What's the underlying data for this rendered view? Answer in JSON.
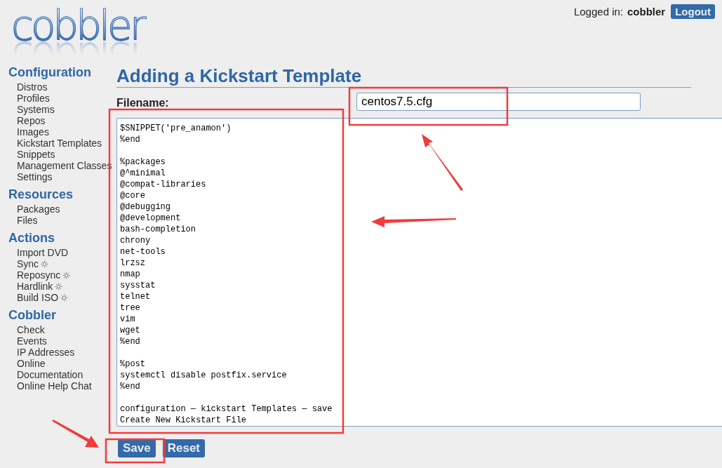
{
  "header": {
    "logo": "cobbler",
    "logged_in_label": "Logged in:",
    "user": "cobbler",
    "logout": "Logout"
  },
  "sidebar": [
    {
      "heading": "Configuration",
      "items": [
        {
          "label": "Distros",
          "kind": "link"
        },
        {
          "label": "Profiles",
          "kind": "link"
        },
        {
          "label": "Systems",
          "kind": "link"
        },
        {
          "label": "Repos",
          "kind": "link"
        },
        {
          "label": "Images",
          "kind": "link"
        },
        {
          "label": "Kickstart Templates",
          "kind": "link"
        },
        {
          "label": "Snippets",
          "kind": "link"
        },
        {
          "label": "Management Classes",
          "kind": "link"
        },
        {
          "label": "Settings",
          "kind": "link"
        }
      ]
    },
    {
      "heading": "Resources",
      "items": [
        {
          "label": "Packages",
          "kind": "link"
        },
        {
          "label": "Files",
          "kind": "link"
        }
      ]
    },
    {
      "heading": "Actions",
      "items": [
        {
          "label": "Import DVD",
          "kind": "link"
        },
        {
          "label": "Sync",
          "kind": "task"
        },
        {
          "label": "Reposync",
          "kind": "task"
        },
        {
          "label": "Hardlink",
          "kind": "task"
        },
        {
          "label": "Build ISO",
          "kind": "task"
        }
      ]
    },
    {
      "heading": "Cobbler",
      "items": [
        {
          "label": "Check",
          "kind": "link"
        },
        {
          "label": "Events",
          "kind": "link"
        },
        {
          "label": "IP Addresses",
          "kind": "link"
        },
        {
          "label": "Online",
          "kind": "link"
        },
        {
          "label": "Documentation",
          "kind": "link"
        },
        {
          "label": "Online Help Chat",
          "kind": "link"
        }
      ]
    }
  ],
  "page": {
    "title": "Adding a Kickstart Template",
    "filename_label": "Filename:",
    "filename": "centos7.5.cfg",
    "editor": {
      "value": "$SNIPPET('pre_anamon')\n%end\n\n%packages\n@^minimal\n@compat-libraries\n@core\n@debugging\n@development\nbash-completion\nchrony\nnet-tools\nlrzsz\nnmap\nsysstat\ntelnet\ntree\nvim\nwget\n%end\n\n%post\nsystemctl disable postfix.service\n%end\n\nconfiguration — kickstart Templates — save\nCreate New Kickstart File"
    },
    "buttons": [
      "Save",
      "Reset"
    ]
  }
}
